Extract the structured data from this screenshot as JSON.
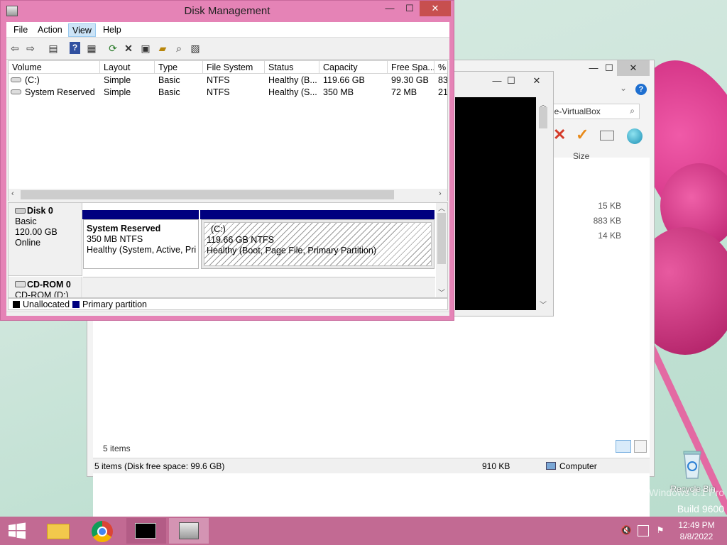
{
  "desktop": {
    "recycle_bin_label": "Recycle Bin",
    "watermark_line1": "Windows 8.1 Pro",
    "watermark_line2": "Build 9600"
  },
  "explorer": {
    "minimize": "—",
    "maximize": "☐",
    "close": "✕",
    "search_text": "le-VirtualBox",
    "size_column": "Size",
    "file_sizes": [
      "15 KB",
      "883 KB",
      "14 KB"
    ],
    "items_count": "5 items",
    "status_left": "5 items (Disk free space: 99.6 GB)",
    "status_size": "910 KB",
    "status_location": "Computer"
  },
  "cmd": {
    "minimize": "—",
    "maximize": "☐",
    "close": "✕"
  },
  "disk_management": {
    "title": "Disk Management",
    "minimize": "—",
    "maximize": "☐",
    "close": "✕",
    "menu": [
      "File",
      "Action",
      "View",
      "Help"
    ],
    "columns": [
      "Volume",
      "Layout",
      "Type",
      "File System",
      "Status",
      "Capacity",
      "Free Spa...",
      "% F"
    ],
    "rows": [
      [
        "(C:)",
        "Simple",
        "Basic",
        "NTFS",
        "Healthy (B...",
        "119.66 GB",
        "99.30 GB",
        "83"
      ],
      [
        "System Reserved",
        "Simple",
        "Basic",
        "NTFS",
        "Healthy (S...",
        "350 MB",
        "72 MB",
        "21"
      ]
    ],
    "disk0": {
      "name": "Disk 0",
      "type": "Basic",
      "size": "120.00 GB",
      "state": "Online",
      "partitions": [
        {
          "name": "System Reserved",
          "size": "350 MB NTFS",
          "status": "Healthy (System, Active, Prir"
        },
        {
          "name": "(C:)",
          "size": "119.66 GB NTFS",
          "status": "Healthy (Boot, Page File, Primary Partition)"
        }
      ]
    },
    "cdrom0": {
      "name": "CD-ROM 0",
      "drive": "CD-ROM (D:)"
    },
    "legend": {
      "unallocated": "Unallocated",
      "primary": "Primary partition"
    }
  },
  "taskbar": {
    "time": "12:49 PM",
    "date": "8/8/2022"
  },
  "colors": {
    "taskbar": "#c26a93",
    "window_frame": "#e583b6",
    "primary_partition": "#00007f"
  }
}
